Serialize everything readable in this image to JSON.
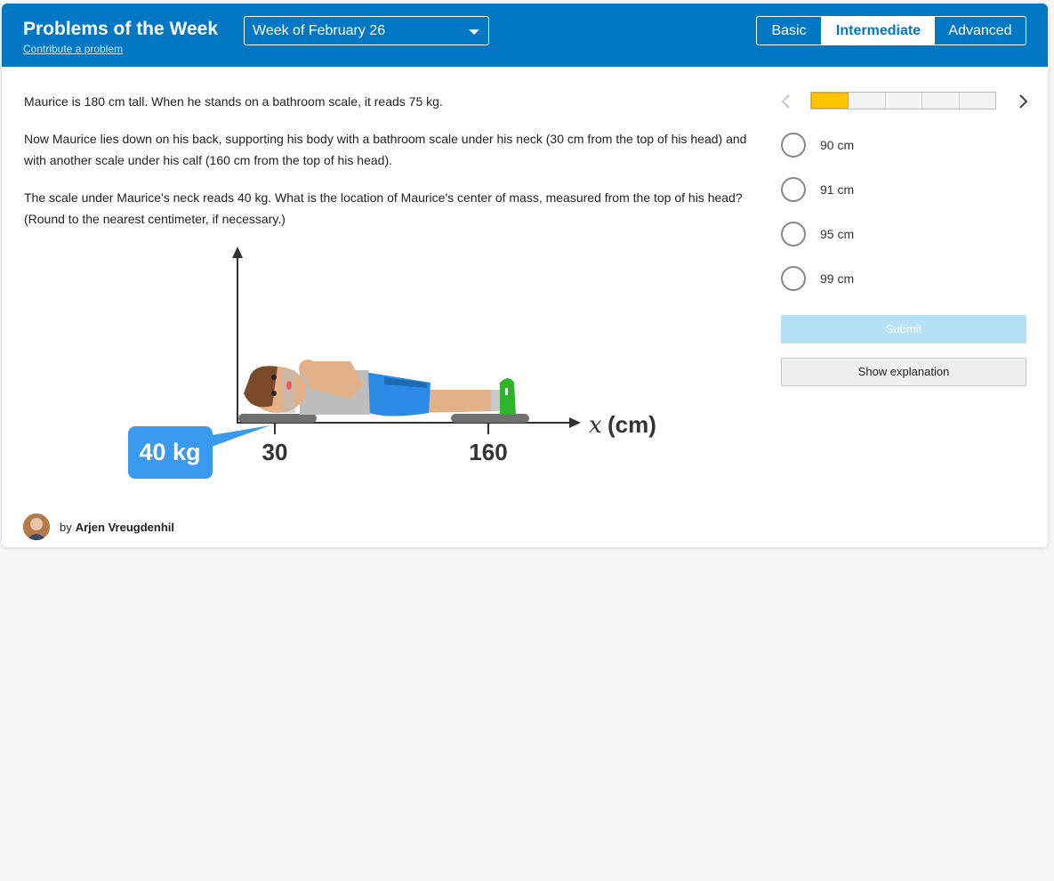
{
  "header": {
    "title": "Problems of the Week",
    "contribute_link": "Contribute a problem",
    "week_select": "Week of February 26",
    "levels": [
      "Basic",
      "Intermediate",
      "Advanced"
    ],
    "selected_level": "Intermediate"
  },
  "problem": {
    "paragraphs": [
      "Maurice is 180 cm tall. When he stands on a bathroom scale, it reads 75 kg.",
      "Now Maurice lies down on his back, supporting his body with a bathroom scale under his neck (30 cm from the top of his head) and with another scale under his calf (160 cm from the top of his head).",
      "The scale under Maurice's neck reads 40 kg. What is the location of Maurice's center of mass, measured from the top of his head? (Round to the nearest centimeter, if necessary.)"
    ],
    "figure": {
      "scale_label": "40 kg",
      "tick_1": "30",
      "tick_2": "160",
      "axis_label": "(cm)",
      "axis_var": "x"
    }
  },
  "progress": {
    "current": 1,
    "total": 5
  },
  "choices": [
    "90 cm",
    "91 cm",
    "95 cm",
    "99 cm"
  ],
  "buttons": {
    "submit": "Submit",
    "explain": "Show explanation"
  },
  "author": {
    "by": "by",
    "name": "Arjen Vreugdenhil"
  },
  "colors": {
    "header": "#0277c3",
    "progress_fill": "#ffc400",
    "submit_bg": "#b6e0f6",
    "callout": "#3a9af0"
  }
}
